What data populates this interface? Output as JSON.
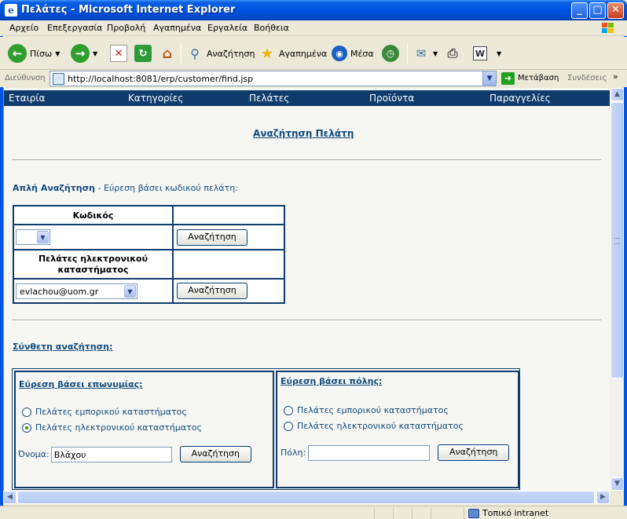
{
  "window": {
    "title": "Πελάτες - Microsoft Internet Explorer",
    "minimize": "_",
    "maximize": "□",
    "close": "✕"
  },
  "menu": [
    "Αρχείο",
    "Επεξεργασία",
    "Προβολή",
    "Αγαπημένα",
    "Εργαλεία",
    "Βοήθεια"
  ],
  "toolbar": {
    "back": "Πίσω",
    "search": "Αναζήτηση",
    "favorites": "Αγαπημένα",
    "media": "Μέσα"
  },
  "address": {
    "label": "Διεύθυνση",
    "url": "http://localhost:8081/erp/customer/find.jsp",
    "go": "Μετάβαση",
    "links": "Συνδέσεις"
  },
  "topnav": [
    "Εταιρία",
    "Κατηγορίες",
    "Πελάτες",
    "Προϊόντα",
    "Παραγγελίες"
  ],
  "page": {
    "title": "Αναζήτηση Πελάτη",
    "simple_search_title": "Απλή Αναζήτηση",
    "simple_search_desc": " - Εύρεση βάσει κωδικού πελάτη:",
    "code_header": "Κωδικός",
    "code_value": "",
    "search_button": "Αναζήτηση",
    "ecustomer_header": "Πελάτες ηλεκτρονικού καταστήματος",
    "email_value": "evlachou@uom.gr",
    "complex_search_title": "Σύνθετη αναζήτηση:",
    "by_name": {
      "title": "Εύρεση βάσει επωνυμίας:",
      "radio_store": "Πελάτες εμπορικού καταστήματος",
      "radio_eshop": "Πελάτες ηλεκτρονικού καταστήματος",
      "selected": "eshop",
      "field_label": "Όνομα:",
      "field_value": "Βλάχου",
      "button": "Αναζήτηση"
    },
    "by_city": {
      "title": "Εύρεση βάσει πόλης:",
      "radio_store": "Πελάτες εμπορικού καταστήματος",
      "radio_eshop": "Πελάτες ηλεκτρονικού καταστήματος",
      "selected": "none",
      "field_label": "Πόλη:",
      "field_value": "",
      "button": "Αναζήτηση"
    }
  },
  "status": {
    "zone": "Τοπικό intranet"
  },
  "colors": {
    "nav_bg": "#0f3b6d",
    "link": "#0f4b7c",
    "title_bar": "#0054e3"
  }
}
